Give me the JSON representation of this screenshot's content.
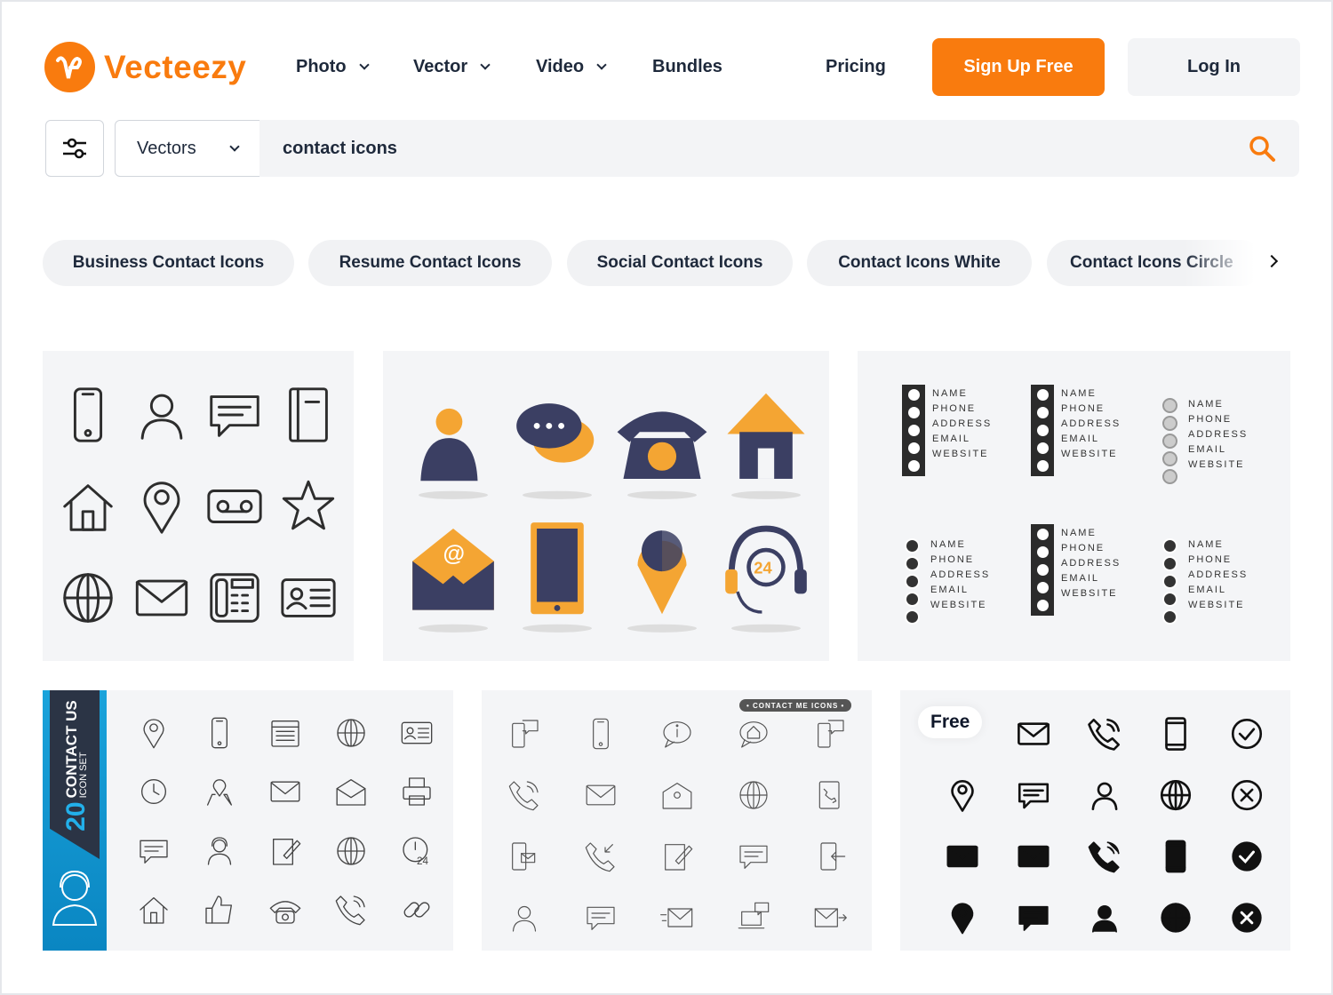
{
  "brand": {
    "name": "Vecteezy",
    "color": "#f97b0e"
  },
  "nav": [
    {
      "label": "Photo",
      "dropdown": true
    },
    {
      "label": "Vector",
      "dropdown": true
    },
    {
      "label": "Video",
      "dropdown": true
    },
    {
      "label": "Bundles",
      "dropdown": false
    },
    {
      "label": "Pricing",
      "dropdown": false
    }
  ],
  "header": {
    "signup": "Sign Up Free",
    "login": "Log In"
  },
  "search": {
    "type": "Vectors",
    "query": "contact icons",
    "icon": "search-icon"
  },
  "chips": [
    "Business Contact Icons",
    "Resume Contact Icons",
    "Social Contact Icons",
    "Contact Icons White",
    "Contact Icons Circle"
  ],
  "results": [
    {
      "icons": [
        "phone",
        "user",
        "chat",
        "notebook",
        "home",
        "pin",
        "cassette",
        "star",
        "globe",
        "mail",
        "fax",
        "idcard"
      ]
    },
    {
      "icons": [
        "support-user",
        "chat-bubbles",
        "telephone",
        "house",
        "email-at",
        "tablet",
        "location-pin",
        "headset-24"
      ],
      "colors": {
        "navy": "#3b3f63",
        "orange": "#f4a533"
      }
    },
    {
      "cards": [
        [
          "NAME",
          "PHONE",
          "ADDRESS",
          "EMAIL",
          "WEBSITE"
        ],
        [
          "NAME",
          "PHONE",
          "ADDRESS",
          "EMAIL",
          "WEBSITE"
        ],
        [
          "NAME",
          "PHONE",
          "ADDRESS",
          "EMAIL",
          "WEBSITE"
        ],
        [
          "NAME",
          "PHONE",
          "ADDRESS",
          "EMAIL",
          "WEBSITE"
        ],
        [
          "NAME",
          "PHONE",
          "ADDRESS",
          "EMAIL",
          "WEBSITE"
        ],
        [
          "NAME",
          "PHONE",
          "ADDRESS",
          "EMAIL",
          "WEBSITE"
        ]
      ]
    },
    {
      "number": "20",
      "title": "CONTACT US",
      "subtitle": "ICON SET",
      "icons": [
        "pin",
        "phone",
        "calendar",
        "globe",
        "idcard",
        "clock",
        "map-pin",
        "mail",
        "mail-open",
        "printer",
        "chat",
        "support-user",
        "edit",
        "globe",
        "clock-24",
        "home",
        "thumbs-up",
        "telephone",
        "phone-ring",
        "link"
      ]
    },
    {
      "badge": "• CONTACT ME ICONS •",
      "icons": [
        "phone-chat",
        "phone",
        "info-chat",
        "home-chat",
        "phone-chat",
        "phone-ring",
        "mail",
        "mail-at",
        "globe",
        "phone-book",
        "phone-mail",
        "phone-in",
        "edit",
        "chat",
        "phone-out",
        "user",
        "chat",
        "mail-fast",
        "laptop-chat",
        "mail-send"
      ]
    },
    {
      "badge": "Free",
      "icons": [
        "mail",
        "phone-ring",
        "tablet",
        "check-circle",
        "pin",
        "chat",
        "user",
        "globe",
        "x-circle",
        "mail",
        "mail",
        "phone-ring",
        "tablet",
        "check-circle",
        "pin",
        "chat",
        "user",
        "globe",
        "x-circle"
      ]
    }
  ]
}
